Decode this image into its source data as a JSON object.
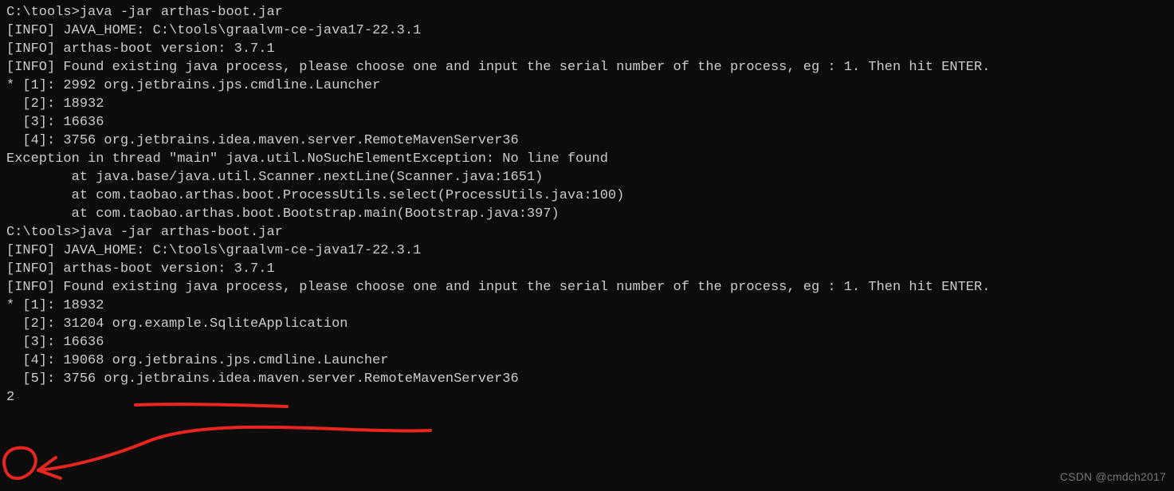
{
  "terminal": {
    "lines": [
      "C:\\tools>java -jar arthas-boot.jar",
      "[INFO] JAVA_HOME: C:\\tools\\graalvm-ce-java17-22.3.1",
      "[INFO] arthas-boot version: 3.7.1",
      "[INFO] Found existing java process, please choose one and input the serial number of the process, eg : 1. Then hit ENTER.",
      "* [1]: 2992 org.jetbrains.jps.cmdline.Launcher",
      "  [2]: 18932 ",
      "  [3]: 16636 ",
      "  [4]: 3756 org.jetbrains.idea.maven.server.RemoteMavenServer36",
      "Exception in thread \"main\" java.util.NoSuchElementException: No line found",
      "        at java.base/java.util.Scanner.nextLine(Scanner.java:1651)",
      "        at com.taobao.arthas.boot.ProcessUtils.select(ProcessUtils.java:100)",
      "        at com.taobao.arthas.boot.Bootstrap.main(Bootstrap.java:397)",
      "",
      "C:\\tools>java -jar arthas-boot.jar",
      "[INFO] JAVA_HOME: C:\\tools\\graalvm-ce-java17-22.3.1",
      "[INFO] arthas-boot version: 3.7.1",
      "[INFO] Found existing java process, please choose one and input the serial number of the process, eg : 1. Then hit ENTER.",
      "* [1]: 18932 ",
      "  [2]: 31204 org.example.SqliteApplication",
      "  [3]: 16636 ",
      "  [4]: 19068 org.jetbrains.jps.cmdline.Launcher",
      "  [5]: 3756 org.jetbrains.idea.maven.server.RemoteMavenServer36",
      "2"
    ],
    "input_value": "2"
  },
  "watermark": "CSDN @cmdch2017",
  "annotation": {
    "color": "#e6261f",
    "stroke_width": 4
  }
}
